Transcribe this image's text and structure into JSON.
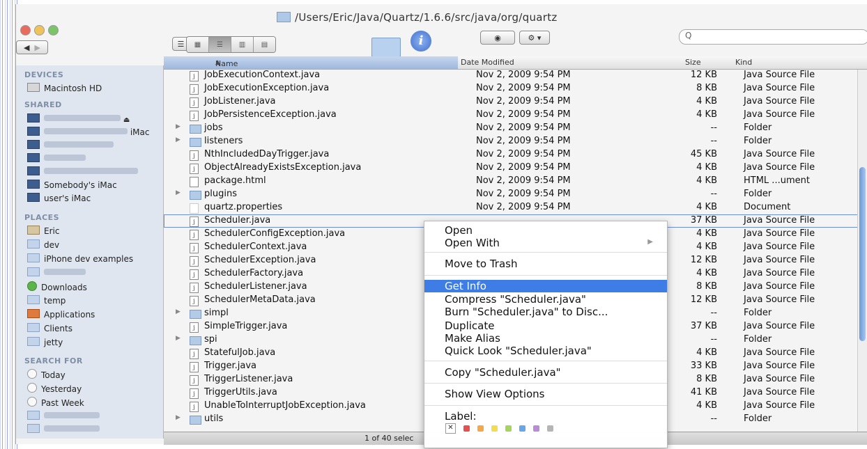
{
  "window": {
    "path": "/Users/Eric/Java/Quartz/1.6.6/src/java/org/quartz",
    "search_placeholder": "Q"
  },
  "sidebar": {
    "devices_head": "DEVICES",
    "devices": [
      "Macintosh HD"
    ],
    "shared_head": "SHARED",
    "shared": [
      "",
      "iMac",
      "",
      "",
      "",
      "Somebody's iMac",
      "user's iMac"
    ],
    "places_head": "PLACES",
    "places": [
      "Eric",
      "dev",
      "iPhone dev examples",
      "",
      "Downloads",
      "temp",
      "Applications",
      "Clients",
      "jetty"
    ],
    "search_head": "SEARCH FOR",
    "search": [
      "Today",
      "Yesterday",
      "Past Week",
      "",
      ""
    ]
  },
  "columns": {
    "name": "Name",
    "date": "Date Modified",
    "size": "Size",
    "kind": "Kind"
  },
  "rows": [
    {
      "name": "JobExecutionContext.java",
      "date": "Nov 2, 2009 9:54 PM",
      "size": "12 KB",
      "kind": "Java Source File",
      "type": "java"
    },
    {
      "name": "JobExecutionException.java",
      "date": "Nov 2, 2009 9:54 PM",
      "size": "8 KB",
      "kind": "Java Source File",
      "type": "java"
    },
    {
      "name": "JobListener.java",
      "date": "Nov 2, 2009 9:54 PM",
      "size": "4 KB",
      "kind": "Java Source File",
      "type": "java"
    },
    {
      "name": "JobPersistenceException.java",
      "date": "Nov 2, 2009 9:54 PM",
      "size": "4 KB",
      "kind": "Java Source File",
      "type": "java"
    },
    {
      "name": "jobs",
      "date": "Nov 2, 2009 9:54 PM",
      "size": "--",
      "kind": "Folder",
      "type": "folder"
    },
    {
      "name": "listeners",
      "date": "Nov 2, 2009 9:54 PM",
      "size": "--",
      "kind": "Folder",
      "type": "folder"
    },
    {
      "name": "NthIncludedDayTrigger.java",
      "date": "Nov 2, 2009 9:54 PM",
      "size": "45 KB",
      "kind": "Java Source File",
      "type": "java"
    },
    {
      "name": "ObjectAlreadyExistsException.java",
      "date": "Nov 2, 2009 9:54 PM",
      "size": "4 KB",
      "kind": "Java Source File",
      "type": "java"
    },
    {
      "name": "package.html",
      "date": "Nov 2, 2009 9:54 PM",
      "size": "4 KB",
      "kind": "HTML ...ument",
      "type": "html"
    },
    {
      "name": "plugins",
      "date": "Nov 2, 2009 9:54 PM",
      "size": "--",
      "kind": "Folder",
      "type": "folder"
    },
    {
      "name": "quartz.properties",
      "date": "Nov 2, 2009 9:54 PM",
      "size": "4 KB",
      "kind": "Document",
      "type": "blank"
    },
    {
      "name": "Scheduler.java",
      "date": "",
      "size": "37 KB",
      "kind": "Java Source File",
      "type": "java",
      "selected": true
    },
    {
      "name": "SchedulerConfigException.java",
      "date": "",
      "size": "4 KB",
      "kind": "Java Source File",
      "type": "java"
    },
    {
      "name": "SchedulerContext.java",
      "date": "",
      "size": "4 KB",
      "kind": "Java Source File",
      "type": "java"
    },
    {
      "name": "SchedulerException.java",
      "date": "",
      "size": "12 KB",
      "kind": "Java Source File",
      "type": "java"
    },
    {
      "name": "SchedulerFactory.java",
      "date": "",
      "size": "4 KB",
      "kind": "Java Source File",
      "type": "java"
    },
    {
      "name": "SchedulerListener.java",
      "date": "",
      "size": "8 KB",
      "kind": "Java Source File",
      "type": "java"
    },
    {
      "name": "SchedulerMetaData.java",
      "date": "",
      "size": "12 KB",
      "kind": "Java Source File",
      "type": "java"
    },
    {
      "name": "simpl",
      "date": "",
      "size": "--",
      "kind": "Folder",
      "type": "folder"
    },
    {
      "name": "SimpleTrigger.java",
      "date": "",
      "size": "37 KB",
      "kind": "Java Source File",
      "type": "java"
    },
    {
      "name": "spi",
      "date": "",
      "size": "--",
      "kind": "Folder",
      "type": "folder"
    },
    {
      "name": "StatefulJob.java",
      "date": "",
      "size": "4 KB",
      "kind": "Java Source File",
      "type": "java"
    },
    {
      "name": "Trigger.java",
      "date": "",
      "size": "33 KB",
      "kind": "Java Source File",
      "type": "java"
    },
    {
      "name": "TriggerListener.java",
      "date": "",
      "size": "8 KB",
      "kind": "Java Source File",
      "type": "java"
    },
    {
      "name": "TriggerUtils.java",
      "date": "",
      "size": "41 KB",
      "kind": "Java Source File",
      "type": "java"
    },
    {
      "name": "UnableToInterruptJobException.java",
      "date": "",
      "size": "4 KB",
      "kind": "Java Source File",
      "type": "java"
    },
    {
      "name": "utils",
      "date": "",
      "size": "--",
      "kind": "Folder",
      "type": "folder"
    }
  ],
  "status": "1 of 40 selec",
  "context_menu": {
    "open": "Open",
    "open_with": "Open With",
    "move_to_trash": "Move to Trash",
    "get_info": "Get Info",
    "compress": "Compress \"Scheduler.java\"",
    "burn": "Burn \"Scheduler.java\" to Disc...",
    "duplicate": "Duplicate",
    "make_alias": "Make Alias",
    "quick_look": "Quick Look \"Scheduler.java\"",
    "copy": "Copy \"Scheduler.java\"",
    "show_view_options": "Show View Options",
    "label": "Label:",
    "label_colors": [
      "#e5514f",
      "#f2a94a",
      "#f2dd52",
      "#a6d45c",
      "#67a7e8",
      "#b98cd7",
      "#b5b5b5"
    ]
  }
}
